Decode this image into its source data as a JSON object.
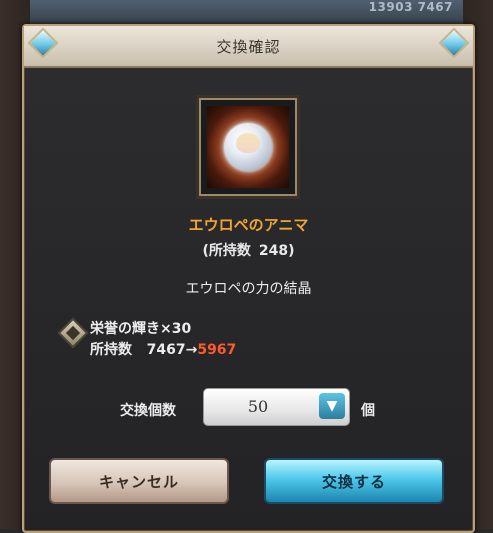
{
  "background": {
    "counter_text": "13903   7467"
  },
  "dialog": {
    "title": "交換確認"
  },
  "item": {
    "name": "エウロペのアニマ",
    "owned_label": "(所持数",
    "owned_count": "248)",
    "description": "エウロペの力の結晶"
  },
  "cost": {
    "item_name": "栄誉の輝き×30",
    "owned_label": "所持数",
    "owned_before": "7467",
    "arrow": "→",
    "owned_after": "5967"
  },
  "quantity": {
    "label": "交換個数",
    "value": "50",
    "unit": "個"
  },
  "buttons": {
    "cancel": "キャンセル",
    "confirm": "交換する"
  },
  "colors": {
    "item_name": "#f2a531",
    "owned_after": "#ff5a2a",
    "confirm_button": "#4fc8ea"
  }
}
